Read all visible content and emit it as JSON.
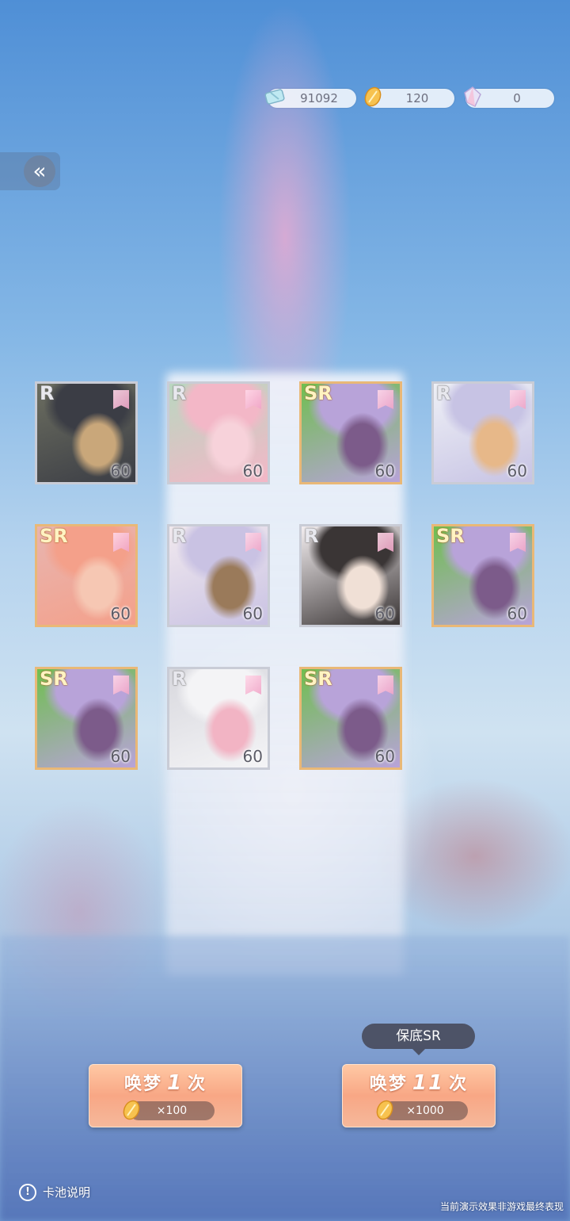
{
  "resources": {
    "ticket": {
      "value": "91092",
      "icon": "ticket-icon"
    },
    "dream_shard": {
      "value": "120",
      "icon": "golden-feather-icon"
    },
    "crystal": {
      "value": "0",
      "icon": "crystal-icon"
    }
  },
  "back": {
    "glyph": "«",
    "icon": "double-chevron-left-icon"
  },
  "cards": [
    {
      "rarity": "R",
      "level": "60",
      "palette": [
        "#3b3d45",
        "#c9a77a",
        "#6c6e60"
      ]
    },
    {
      "rarity": "R",
      "level": "60",
      "palette": [
        "#f3b7c7",
        "#f7d2da",
        "#b9d7c0"
      ]
    },
    {
      "rarity": "SR",
      "level": "60",
      "palette": [
        "#b8a3d9",
        "#7c5b8a",
        "#6fbf4f"
      ]
    },
    {
      "rarity": "R",
      "level": "60",
      "palette": [
        "#c7c3e4",
        "#e7b889",
        "#eef0f6"
      ]
    },
    {
      "rarity": "SR",
      "level": "60",
      "palette": [
        "#f4a08a",
        "#f6c7b3",
        "#e8b5b0"
      ]
    },
    {
      "rarity": "R",
      "level": "60",
      "palette": [
        "#c9c2e3",
        "#9a7a5a",
        "#f1e9ee"
      ]
    },
    {
      "rarity": "R",
      "level": "60",
      "palette": [
        "#3a3535",
        "#f0e0d6",
        "#f3eef0"
      ]
    },
    {
      "rarity": "SR",
      "level": "60",
      "palette": [
        "#b8a3d9",
        "#7c5b8a",
        "#6fbf4f"
      ]
    },
    {
      "rarity": "SR",
      "level": "60",
      "palette": [
        "#b8a3d9",
        "#7c5b8a",
        "#6fbf4f"
      ]
    },
    {
      "rarity": "R",
      "level": "60",
      "palette": [
        "#f4f4f6",
        "#f2b4c4",
        "#d8d8de"
      ]
    },
    {
      "rarity": "SR",
      "level": "60",
      "palette": [
        "#b8a3d9",
        "#7c5b8a",
        "#6fbf4f"
      ]
    }
  ],
  "guarantee_tooltip": "保底SR",
  "summon_single": {
    "prefix": "唤梦",
    "count": "1",
    "suffix": "次",
    "cost": "×100"
  },
  "summon_multi": {
    "prefix": "唤梦",
    "count": "11",
    "suffix": "次",
    "cost": "×1000"
  },
  "pool_info": {
    "icon_glyph": "!",
    "label": "卡池说明"
  },
  "disclaimer": "当前演示效果非游戏最终表现"
}
